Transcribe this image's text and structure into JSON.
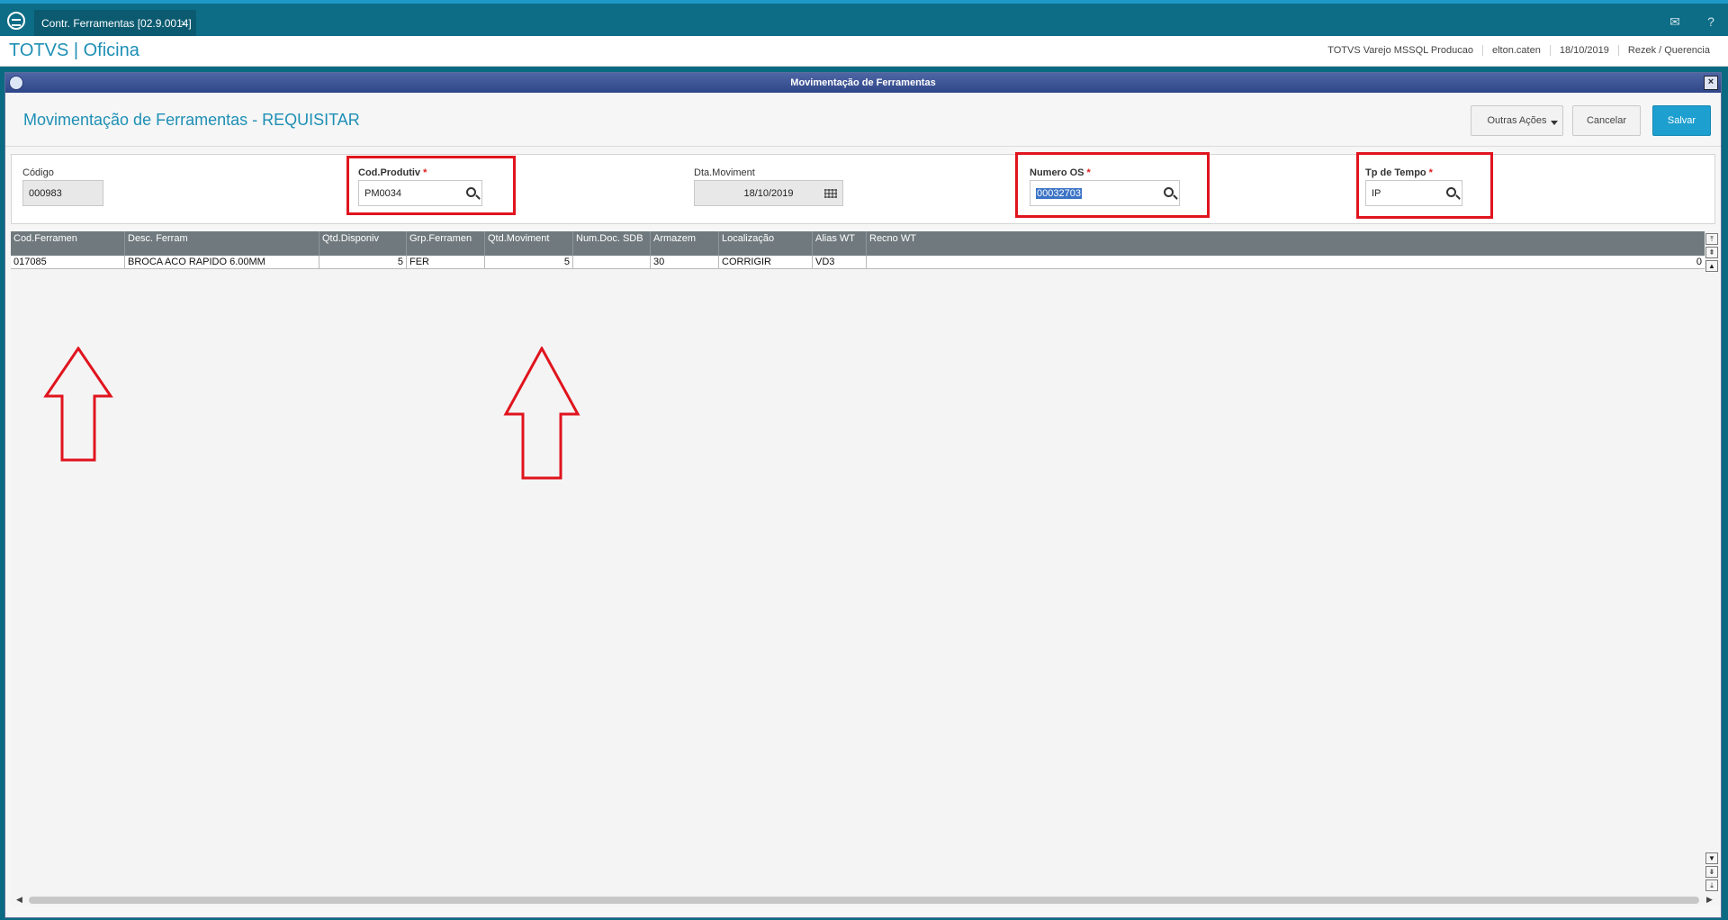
{
  "topbar": {
    "tab_label": "Contr. Ferramentas [02.9.0014]",
    "tab_close": "×",
    "mail_icon": "envelope-icon",
    "help_icon": "help-icon"
  },
  "appbar": {
    "brand": "TOTVS | Oficina",
    "environment": "TOTVS Varejo MSSQL Producao",
    "user": "elton.caten",
    "date": "18/10/2019",
    "branch": "Rezek / Querencia"
  },
  "dialog": {
    "title": "Movimentação de Ferramentas",
    "page_title": "Movimentação de Ferramentas - REQUISITAR",
    "buttons": {
      "more": "Outras Ações",
      "cancel": "Cancelar",
      "save": "Salvar"
    }
  },
  "form": {
    "codigo": {
      "label": "Código",
      "value": "000983"
    },
    "cod_produtiv": {
      "label": "Cod.Produtiv",
      "required": "*",
      "value": "PM0034"
    },
    "dta_moviment": {
      "label": "Dta.Moviment",
      "value": "18/10/2019"
    },
    "numero_os": {
      "label": "Numero OS",
      "required": "*",
      "value": "00032703"
    },
    "tp_tempo": {
      "label": "Tp de Tempo",
      "required": "*",
      "value": "IP"
    }
  },
  "grid": {
    "columns": [
      "Cod.Ferramen",
      "Desc. Ferram",
      "Qtd.Disponiv",
      "Grp.Ferramen",
      "Qtd.Moviment",
      "Num.Doc. SDB",
      "Armazem",
      "Localização",
      "Alias WT",
      "Recno WT"
    ],
    "rows": [
      [
        "017085",
        "BROCA ACO RAPIDO 6.00MM",
        "5",
        "FER",
        "5",
        "",
        "30",
        "CORRIGIR",
        "VD3",
        "0"
      ]
    ]
  },
  "colors": {
    "accent": "#1e8fb5",
    "highlight": "#e0141e",
    "save_button": "#1d9fcf"
  }
}
